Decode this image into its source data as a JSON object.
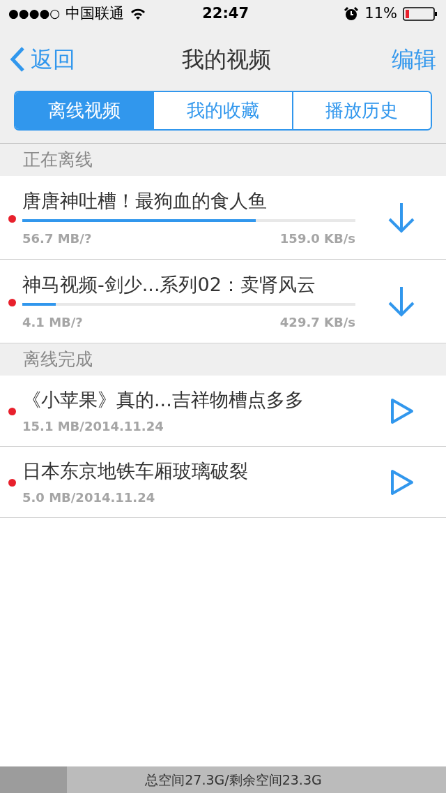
{
  "status_bar": {
    "signal": "●●●●○",
    "carrier": "中国联通",
    "time": "22:47",
    "battery": "11%"
  },
  "nav": {
    "back": "返回",
    "title": "我的视频",
    "action": "编辑"
  },
  "tabs": [
    {
      "label": "离线视频",
      "selected": true
    },
    {
      "label": "我的收藏",
      "selected": false
    },
    {
      "label": "播放历史",
      "selected": false
    }
  ],
  "sections": [
    {
      "title": "正在离线",
      "items": [
        {
          "kind": "downloading",
          "title": "唐唐神吐槽！最狗血的食人鱼",
          "unread": true,
          "level": 0.7,
          "size": "56.7 MB/?",
          "speed": "159.0 KB/s"
        },
        {
          "kind": "downloading",
          "title": "神马视频-剑少...系列02：卖肾风云",
          "unread": true,
          "level": 0.1,
          "size": "4.1 MB/?",
          "speed": "429.7 KB/s"
        }
      ]
    },
    {
      "title": "离线完成",
      "items": [
        {
          "kind": "done",
          "title": "《小苹果》真的...吉祥物槽点多多",
          "unread": true,
          "size": "15.1 MB/2014.11.24"
        },
        {
          "kind": "done",
          "title": "日本东京地铁车厢玻璃破裂",
          "unread": true,
          "size": "5.0 MB/2014.11.24"
        }
      ]
    }
  ],
  "storage": {
    "text": "总空间27.3G/剩余空间23.3G",
    "level": 0.15
  }
}
